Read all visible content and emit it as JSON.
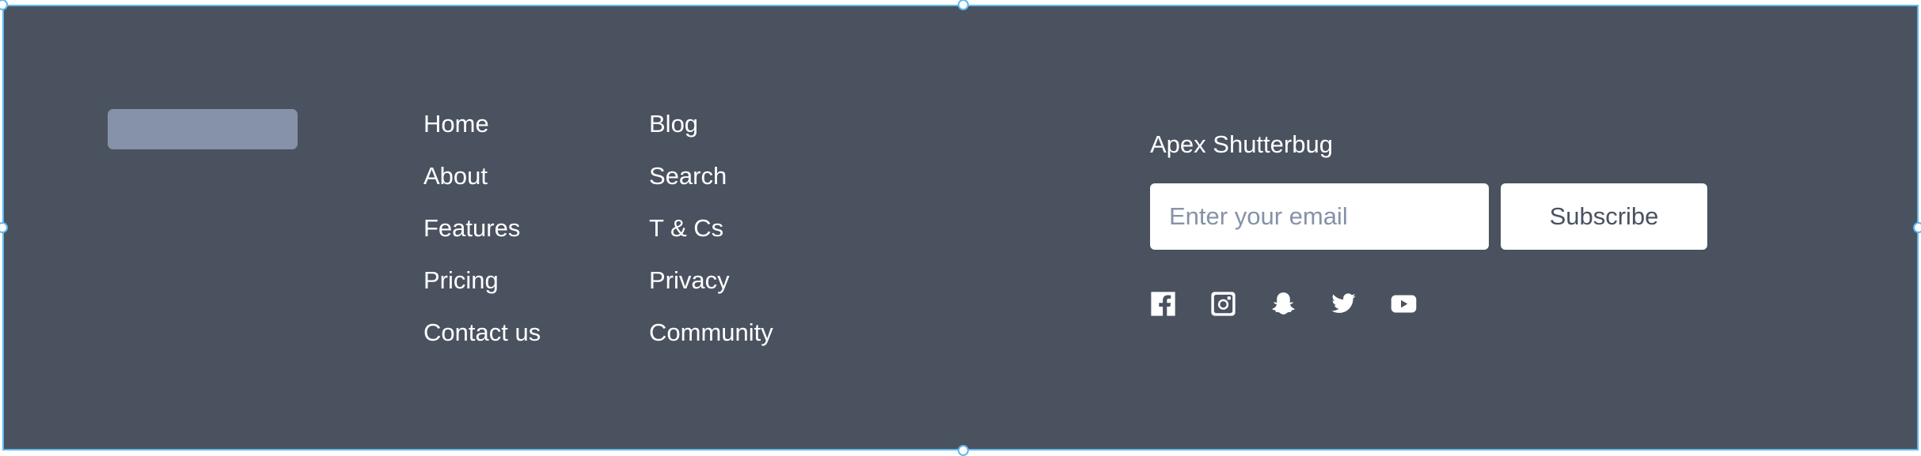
{
  "footer": {
    "logo": "logo-placeholder",
    "nav_columns": [
      {
        "links": [
          {
            "label": "Home"
          },
          {
            "label": "About"
          },
          {
            "label": "Features"
          },
          {
            "label": "Pricing"
          },
          {
            "label": "Contact us"
          }
        ]
      },
      {
        "links": [
          {
            "label": "Blog"
          },
          {
            "label": "Search"
          },
          {
            "label": "T & Cs"
          },
          {
            "label": "Privacy"
          },
          {
            "label": "Community"
          }
        ]
      }
    ],
    "brand_name": "Apex Shutterbug",
    "newsletter": {
      "email_placeholder": "Enter your email",
      "email_value": "",
      "subscribe_label": "Subscribe"
    },
    "social_icons": [
      "facebook-icon",
      "instagram-icon",
      "snapchat-icon",
      "twitter-icon",
      "youtube-icon"
    ]
  },
  "colors": {
    "background": "#4a5260",
    "logo_placeholder": "#8592a8",
    "text": "#ffffff",
    "selection": "#62b8e8"
  }
}
